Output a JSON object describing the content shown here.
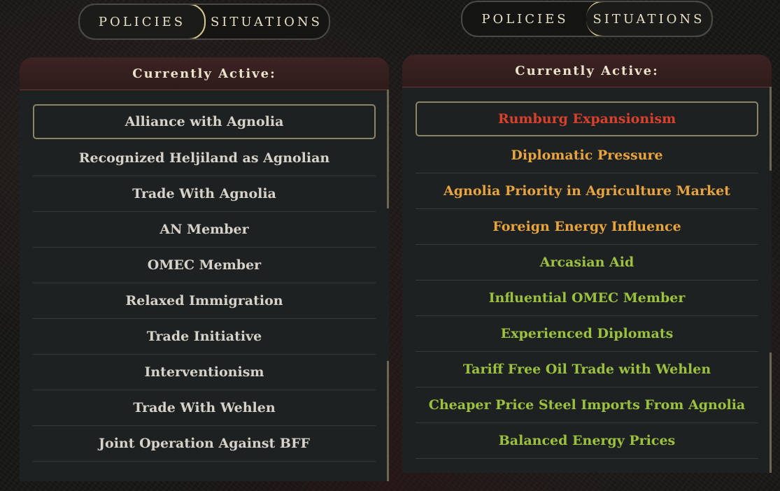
{
  "left": {
    "tabs": [
      {
        "label": "POLICIES",
        "active": true
      },
      {
        "label": "SITUATIONS",
        "active": false
      }
    ],
    "header": "Currently Active:",
    "items": [
      {
        "label": "Alliance with Agnolia",
        "color": "#d6d2c9",
        "selected": true
      },
      {
        "label": "Recognized Heljiland as Agnolian",
        "color": "#d6d2c9"
      },
      {
        "label": "Trade With Agnolia",
        "color": "#d6d2c9"
      },
      {
        "label": "AN Member",
        "color": "#d6d2c9"
      },
      {
        "label": "OMEC Member",
        "color": "#d6d2c9"
      },
      {
        "label": "Relaxed Immigration",
        "color": "#d6d2c9"
      },
      {
        "label": "Trade Initiative",
        "color": "#d6d2c9"
      },
      {
        "label": "Interventionism",
        "color": "#d6d2c9"
      },
      {
        "label": "Trade With Wehlen",
        "color": "#d6d2c9"
      },
      {
        "label": "Joint Operation Against BFF",
        "color": "#d6d2c9"
      }
    ]
  },
  "right": {
    "tabs": [
      {
        "label": "POLICIES",
        "active": false
      },
      {
        "label": "SITUATIONS",
        "active": true
      }
    ],
    "header": "Currently Active:",
    "items": [
      {
        "label": "Rumburg Expansionism",
        "color": "#d9412c",
        "selected": true
      },
      {
        "label": "Diplomatic Pressure",
        "color": "#e8a43e"
      },
      {
        "label": "Agnolia Priority in Agriculture Market",
        "color": "#e8a43e"
      },
      {
        "label": "Foreign Energy Influence",
        "color": "#e8a43e"
      },
      {
        "label": "Arcasian Aid",
        "color": "#9cc13e"
      },
      {
        "label": "Influential OMEC Member",
        "color": "#9cc13e"
      },
      {
        "label": "Experienced Diplomats",
        "color": "#9cc13e"
      },
      {
        "label": "Tariff Free Oil Trade with Wehlen",
        "color": "#9cc13e"
      },
      {
        "label": "Cheaper Price Steel Imports From Agnolia",
        "color": "#9cc13e"
      },
      {
        "label": "Balanced Energy Prices",
        "color": "#9cc13e"
      }
    ]
  }
}
